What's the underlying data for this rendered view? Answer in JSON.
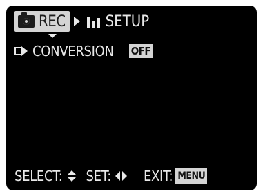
{
  "tabs": {
    "rec": {
      "label": "REC",
      "icon": "camera-icon",
      "active": true
    },
    "setup": {
      "label": "SETUP",
      "icon": "setup-icon",
      "active": false
    }
  },
  "setting": {
    "icon": "conversion-lens-icon",
    "label": "CONVERSION",
    "value": "OFF"
  },
  "footer": {
    "select_label": "SELECT:",
    "select_icon": "up-down-arrows-icon",
    "set_label": "SET:",
    "set_icon": "left-right-arrows-icon",
    "exit_label": "EXIT:",
    "exit_button": "MENU"
  },
  "colors": {
    "background": "#000000",
    "text": "#e8e8e8",
    "highlight": "#d4d4d4"
  }
}
